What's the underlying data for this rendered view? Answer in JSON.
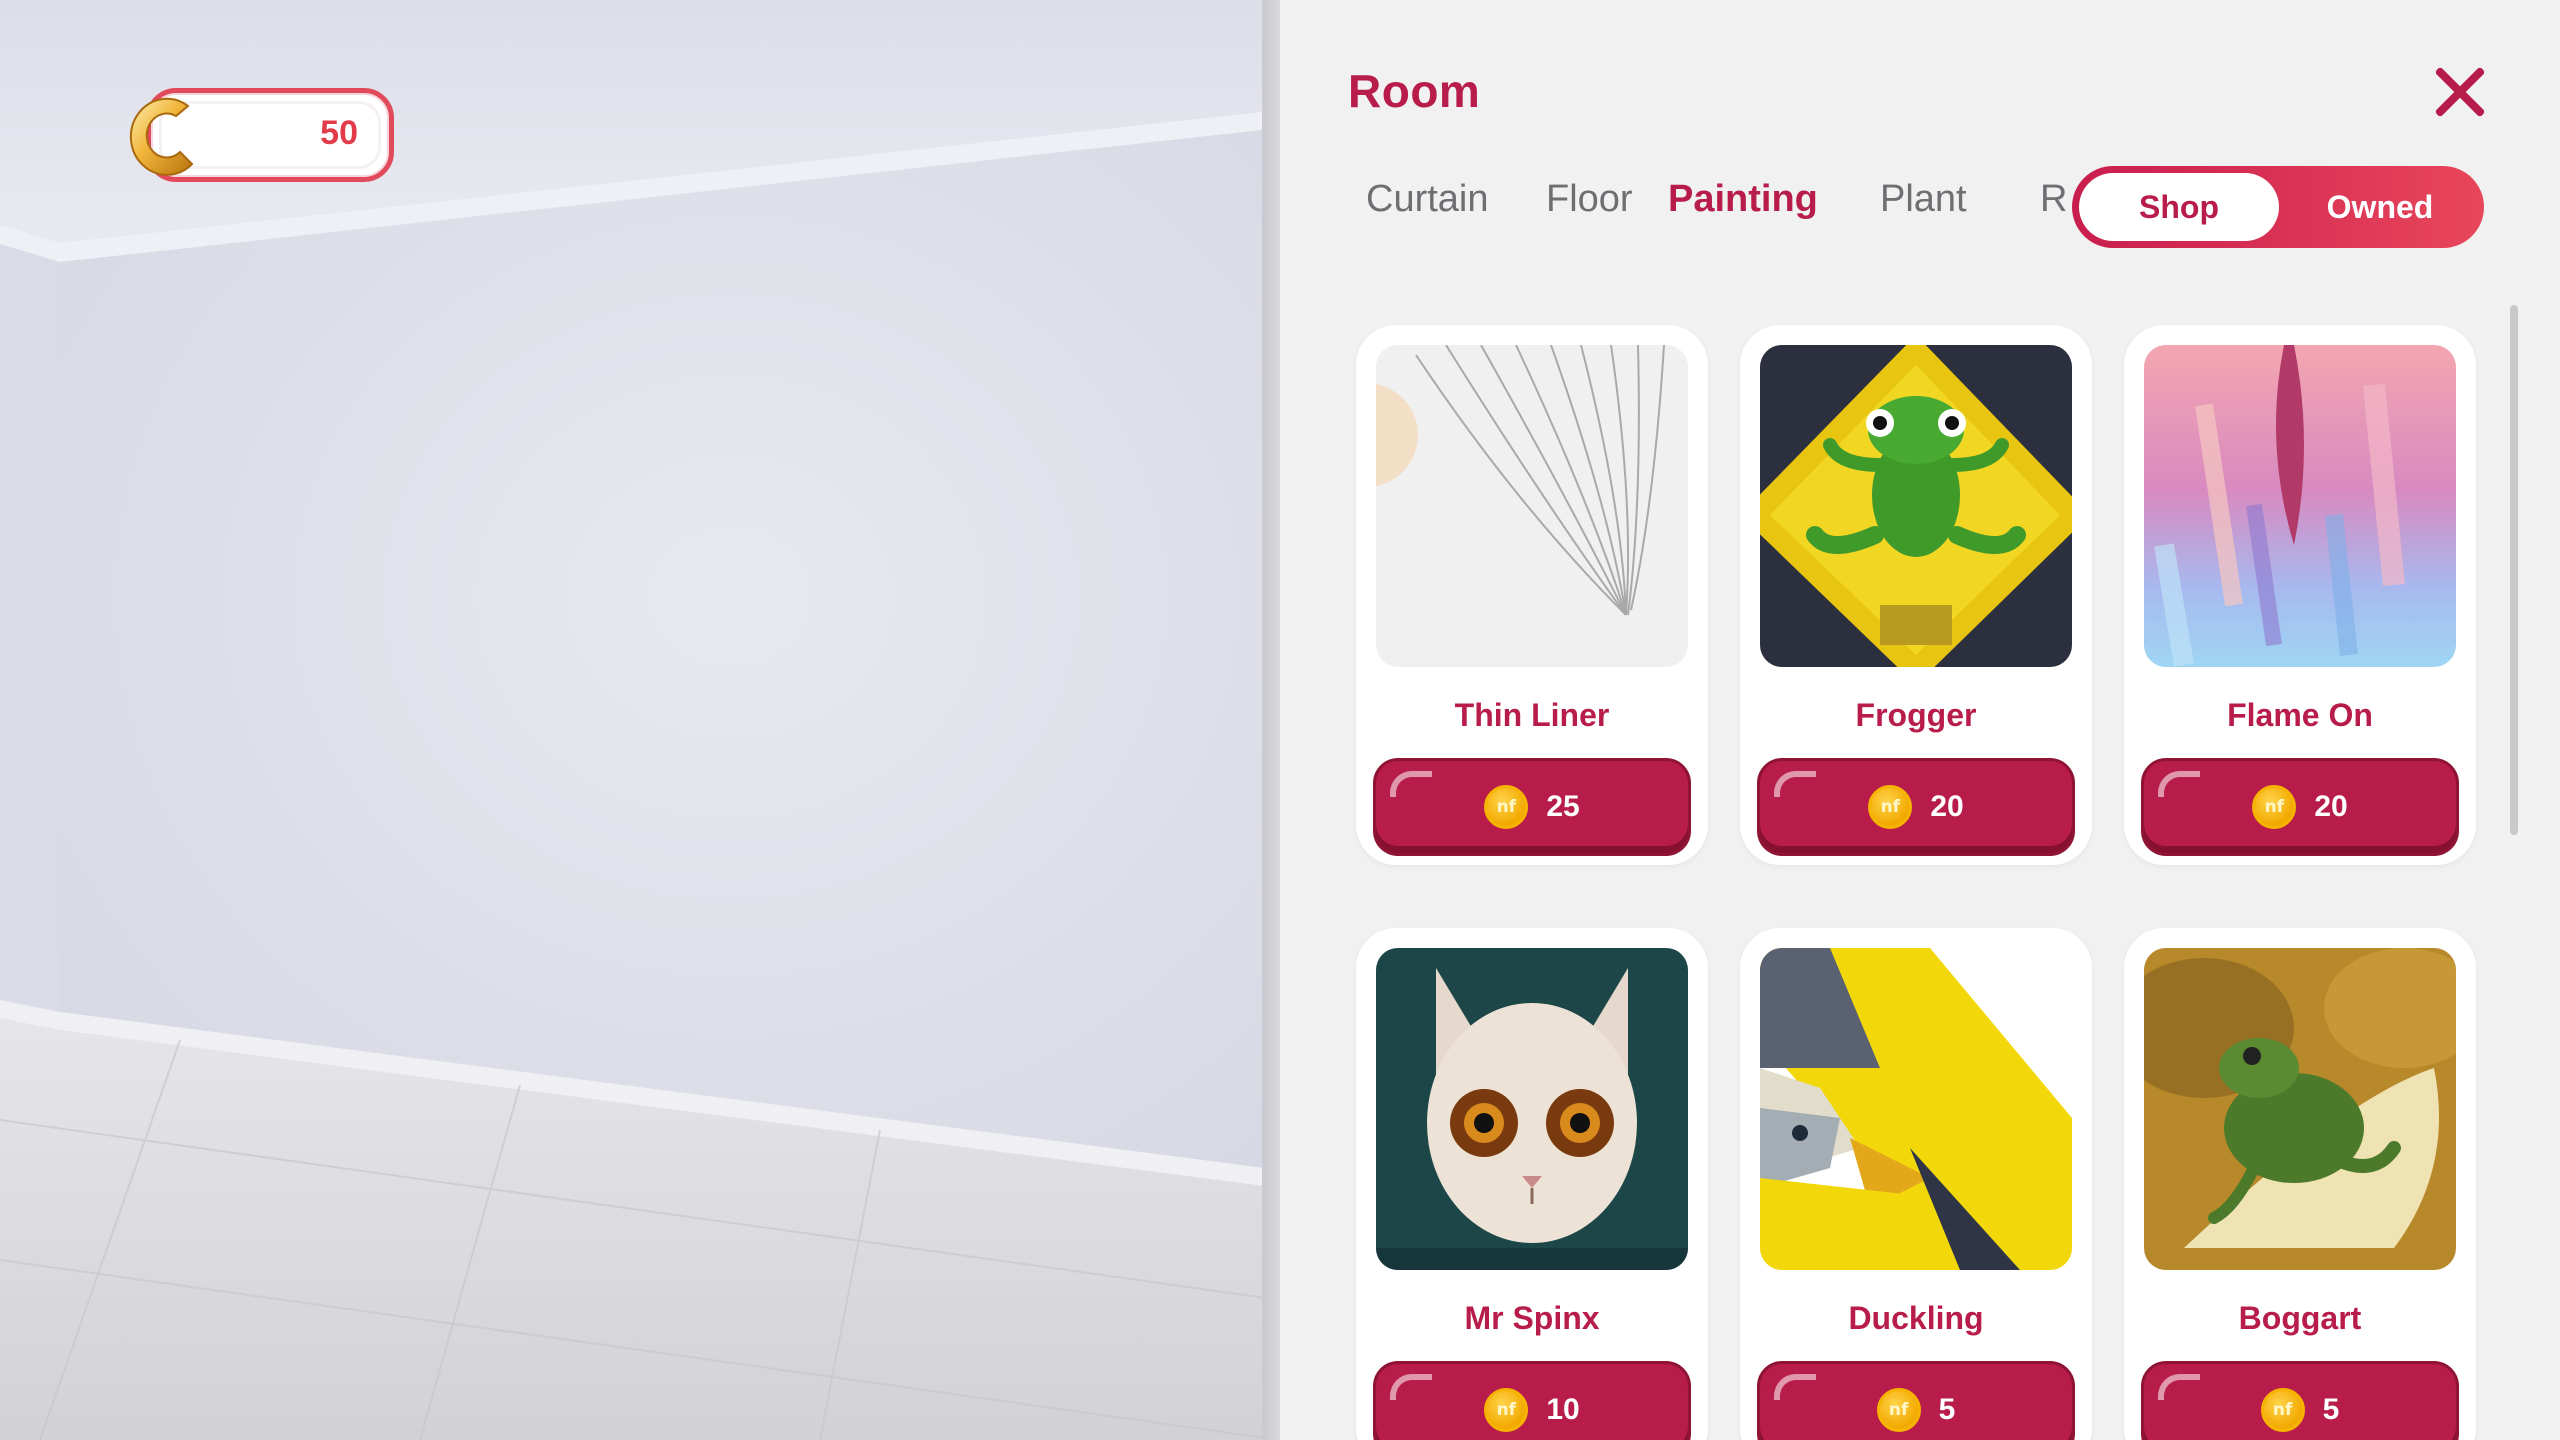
{
  "hud": {
    "coins": "50",
    "coin_letter": "C"
  },
  "panel": {
    "title": "Room",
    "tabs": [
      {
        "label": "Curtain",
        "active": false
      },
      {
        "label": "Floor",
        "active": false
      },
      {
        "label": "Painting",
        "active": true
      },
      {
        "label": "Plant",
        "active": false
      },
      {
        "label": "R",
        "active": false
      }
    ],
    "toggle": {
      "shop_label": "Shop",
      "owned_label": "Owned",
      "selected": "Shop"
    },
    "items": [
      {
        "name": "Thin Liner",
        "price": "25",
        "art": "thin-liner"
      },
      {
        "name": "Frogger",
        "price": "20",
        "art": "frogger"
      },
      {
        "name": "Flame On",
        "price": "20",
        "art": "flame-on"
      },
      {
        "name": "Mr Spinx",
        "price": "10",
        "art": "mr-spinx"
      },
      {
        "name": "Duckling",
        "price": "5",
        "art": "duckling"
      },
      {
        "name": "Boggart",
        "price": "5",
        "art": "boggart"
      }
    ],
    "currency_icon_glyph": "nf"
  },
  "colors": {
    "accent": "#b81c4b",
    "hud_border": "#e04a5a",
    "coin": "#f2a900"
  }
}
